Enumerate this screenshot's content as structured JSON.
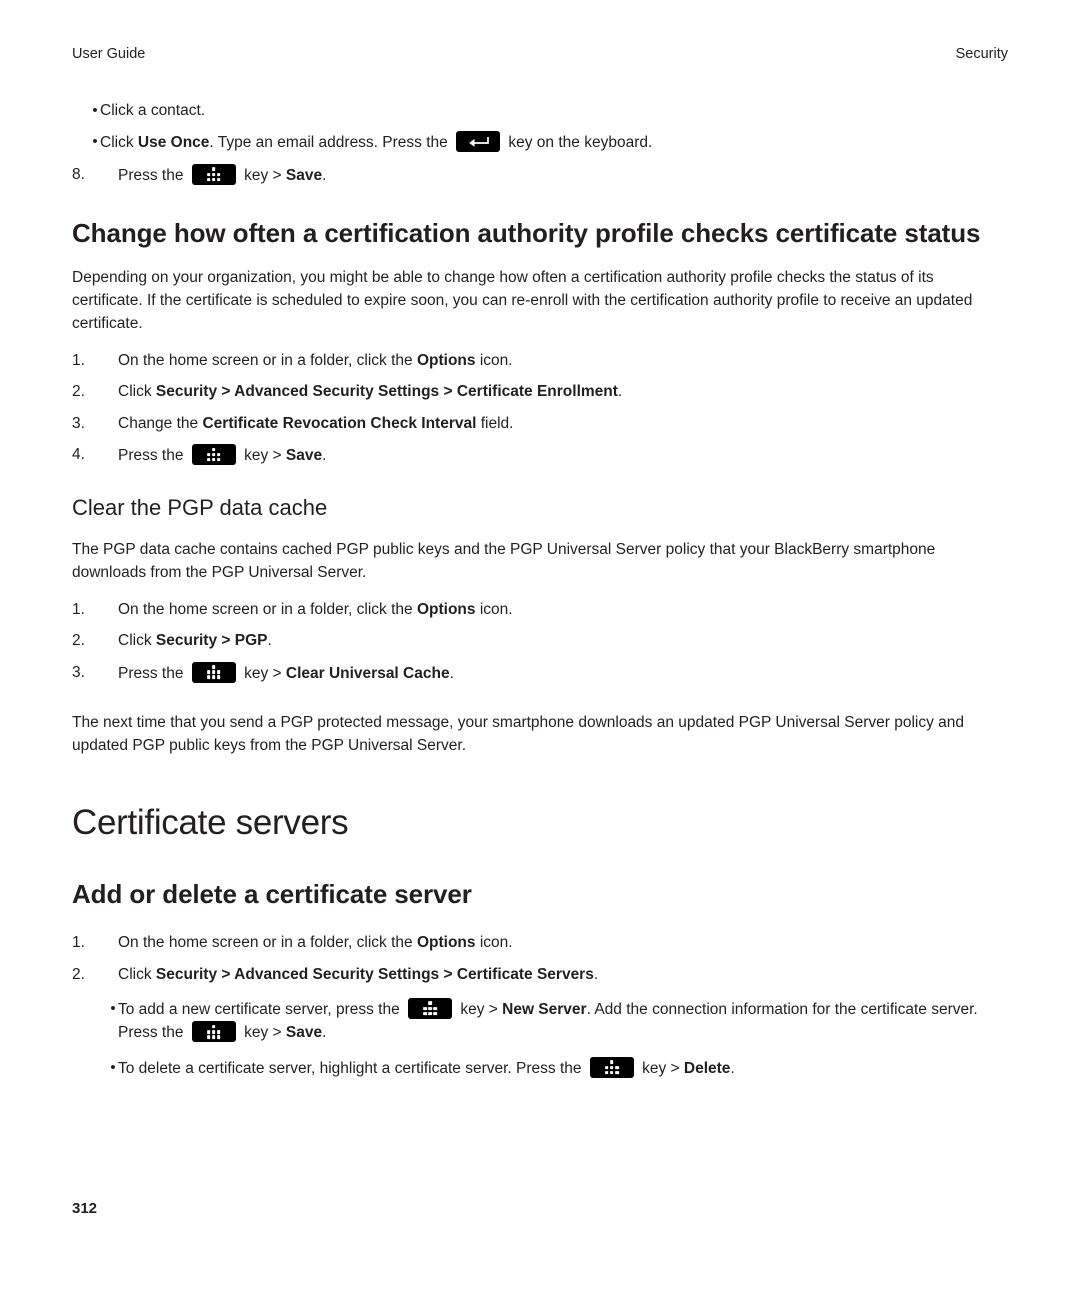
{
  "header": {
    "left": "User Guide",
    "right": "Security"
  },
  "footer": {
    "page_number": "312"
  },
  "top_list": {
    "bullets": [
      {
        "text": "Click a contact."
      }
    ],
    "bullet2": {
      "pre": "Click ",
      "bold1": "Use Once",
      "mid": ". Type an email address. Press the ",
      "post": " key on the keyboard."
    },
    "step8": {
      "num": "8.",
      "pre": "Press the ",
      "mid": " key > ",
      "bold": "Save",
      "post": "."
    }
  },
  "section1": {
    "heading": "Change how often a certification authority profile checks certificate status",
    "paragraph": "Depending on your organization, you might be able to change how often a certification authority profile checks the status of its certificate. If the certificate is scheduled to expire soon, you can re-enroll with the certification authority profile to receive an updated certificate.",
    "steps": {
      "s1": {
        "num": "1.",
        "pre": "On the home screen or in a folder, click the ",
        "bold": "Options",
        "post": " icon."
      },
      "s2": {
        "num": "2.",
        "pre": "Click ",
        "bold1": "Security",
        "sep1": " > ",
        "bold2": "Advanced Security Settings",
        "sep2": " > ",
        "bold3": "Certificate Enrollment",
        "post": "."
      },
      "s3": {
        "num": "3.",
        "pre": "Change the ",
        "bold": "Certificate Revocation Check Interval",
        "post": " field."
      },
      "s4": {
        "num": "4.",
        "pre": "Press the ",
        "mid": " key > ",
        "bold": "Save",
        "post": "."
      }
    }
  },
  "section2": {
    "heading": "Clear the PGP data cache",
    "paragraph": "The PGP data cache contains cached PGP public keys and the PGP Universal Server policy that your BlackBerry smartphone downloads from the PGP Universal Server.",
    "steps": {
      "s1": {
        "num": "1.",
        "pre": "On the home screen or in a folder, click the ",
        "bold": "Options",
        "post": " icon."
      },
      "s2": {
        "num": "2.",
        "pre": "Click ",
        "bold1": "Security",
        "sep1": " > ",
        "bold2": "PGP",
        "post": "."
      },
      "s3": {
        "num": "3.",
        "pre": "Press the ",
        "mid": " key > ",
        "bold": "Clear Universal Cache",
        "post": "."
      }
    },
    "closing_paragraph": "The next time that you send a PGP protected message, your smartphone downloads an updated PGP Universal Server policy and updated PGP public keys from the PGP Universal Server."
  },
  "chapter": {
    "title": "Certificate servers"
  },
  "section3": {
    "heading": "Add or delete a certificate server",
    "steps": {
      "s1": {
        "num": "1.",
        "pre": "On the home screen or in a folder, click the ",
        "bold": "Options",
        "post": " icon."
      },
      "s2": {
        "num": "2.",
        "pre": "Click ",
        "bold1": "Security",
        "sep1": " > ",
        "bold2": "Advanced Security Settings",
        "sep2": " > ",
        "bold3": "Certificate Servers",
        "post": "."
      }
    },
    "bullets": {
      "b1": {
        "pre": "To add a new certificate server, press the ",
        "mid": " key > ",
        "bold1": "New Server",
        "mid2": ". Add the connection information for the certificate server. Press the ",
        "mid3": " key > ",
        "bold2": "Save",
        "post": "."
      },
      "b2": {
        "pre": "To delete a certificate server, highlight a certificate server. Press the ",
        "mid": " key > ",
        "bold": "Delete",
        "post": "."
      }
    }
  },
  "icons": {
    "menu_key": "blackberry-menu-key-icon",
    "enter_key": "enter-key-icon",
    "bullet_char": "•"
  }
}
